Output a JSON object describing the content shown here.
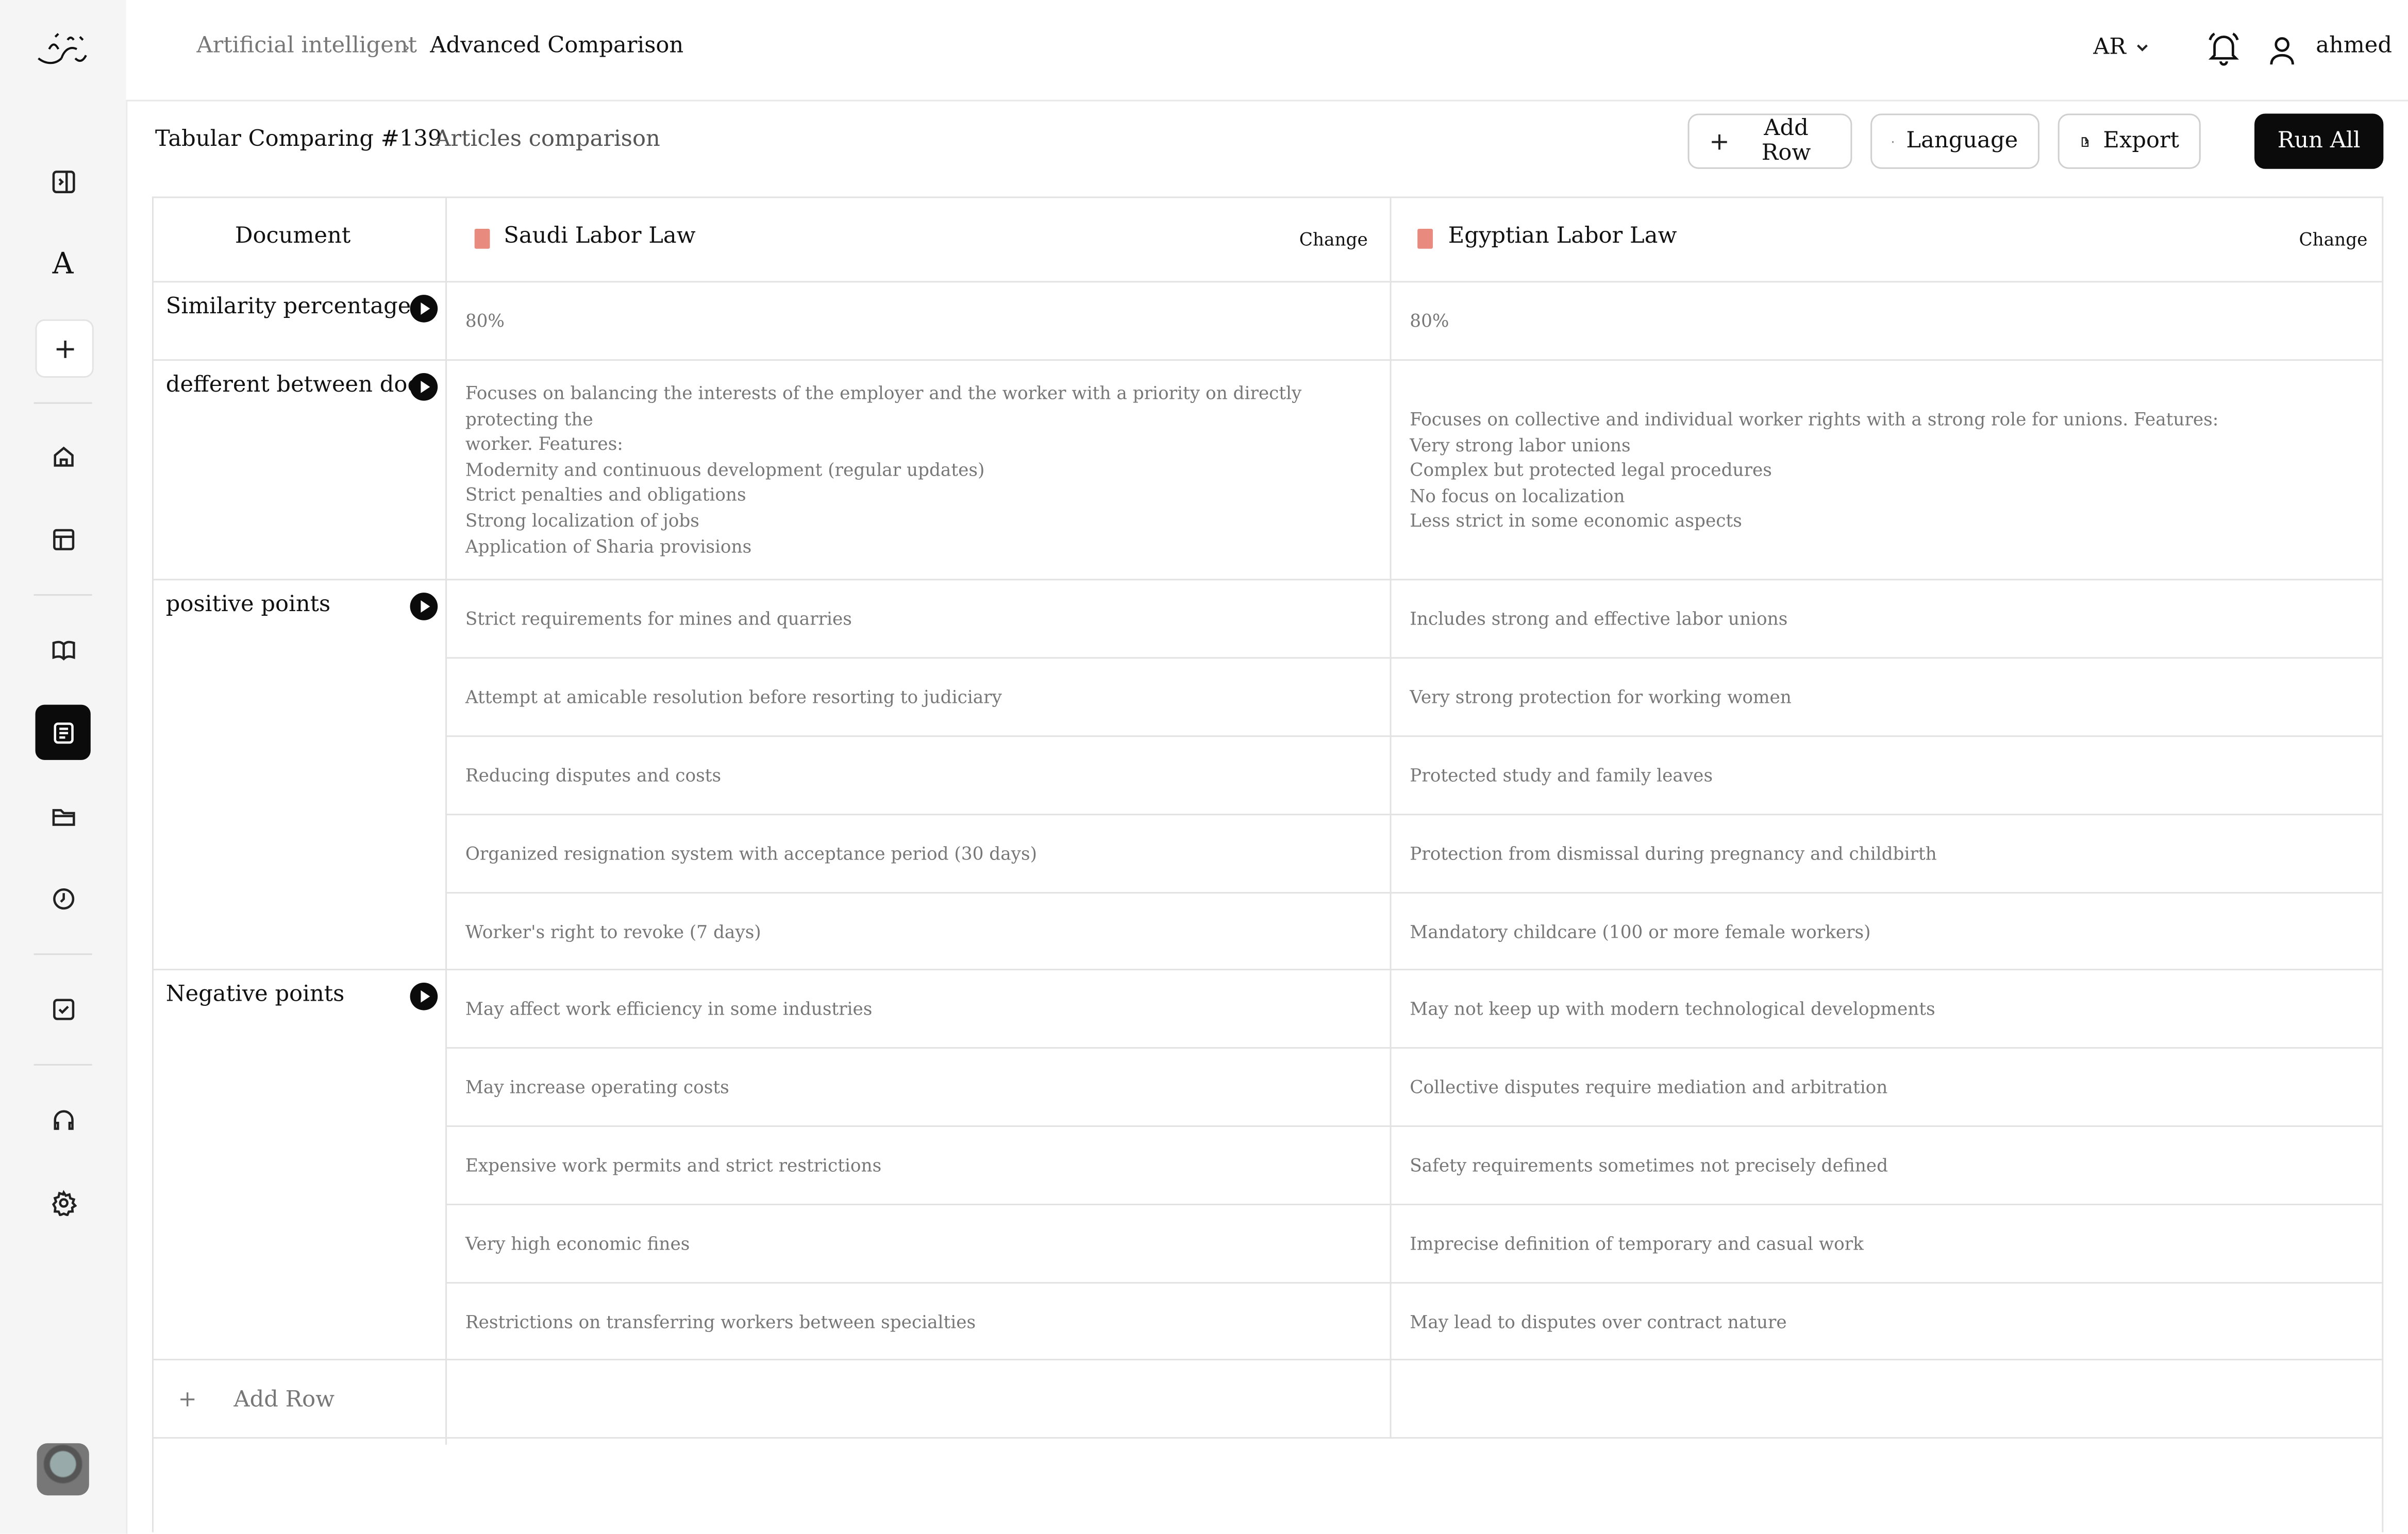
{
  "breadcrumb": {
    "parent": "Artificial intelligent",
    "separator": "›",
    "current": "Advanced Comparison"
  },
  "header": {
    "language": "AR",
    "username": "ahmed"
  },
  "sidebar": {
    "font_glyph": "A",
    "icons": [
      "sidebar-collapse-icon",
      "font-icon",
      "plus-icon",
      "home-icon",
      "table-icon",
      "book-icon",
      "document-compare-icon",
      "folder-icon",
      "clock-icon",
      "checkbox-icon",
      "headset-icon",
      "gear-icon"
    ]
  },
  "toolbar": {
    "title": "Tabular Comparing #139",
    "subtitle": "Articles comparison",
    "add_row": "Add Row",
    "language": "Language",
    "export": "Export",
    "run_all": "Run All"
  },
  "table": {
    "corner": "Document",
    "documents": [
      {
        "name": "Saudi Labor Law",
        "change": "Change"
      },
      {
        "name": "Egyptian Labor Law",
        "change": "Change"
      }
    ],
    "rows": {
      "similarity": {
        "label": "Similarity percentage",
        "values": [
          "80%",
          "80%"
        ]
      },
      "difference": {
        "label": "defferent between docs",
        "col1": [
          "Focuses on balancing the interests of the employer and the worker with a priority on directly protecting the",
          "worker. Features:",
          "Modernity and continuous development (regular updates)",
          "Strict penalties and obligations",
          "Strong localization of jobs",
          "Application of Sharia provisions"
        ],
        "col2": [
          "Focuses on collective and individual worker rights with a strong role for unions. Features:",
          "Very strong labor unions",
          "Complex but protected legal procedures",
          "No focus on localization",
          "Less strict in some economic aspects"
        ]
      },
      "positive": {
        "label": "positive points",
        "col1": [
          "Strict requirements for mines and quarries",
          "Attempt at amicable resolution before resorting to judiciary",
          "Reducing disputes and costs",
          "Organized resignation system with acceptance period (30 days)",
          "Worker's right to revoke (7 days)"
        ],
        "col2": [
          "Includes strong and effective labor unions",
          "Very strong protection for working women",
          "Protected study and family leaves",
          "Protection from dismissal during pregnancy and childbirth",
          "Mandatory childcare (100 or more female workers)"
        ]
      },
      "negative": {
        "label": "Negative points",
        "col1": [
          "May affect work efficiency in some industries",
          "May increase operating costs",
          "Expensive work permits and strict restrictions",
          "Very high economic fines",
          "Restrictions on transferring workers between specialties"
        ],
        "col2": [
          "May not keep up with modern technological developments",
          "Collective disputes require mediation and arbitration",
          "Safety requirements sometimes not precisely defined",
          "Imprecise definition of temporary and casual work",
          "May lead to disputes over contract nature"
        ]
      }
    },
    "add_row": {
      "plus": "+",
      "label": "Add Row"
    }
  }
}
